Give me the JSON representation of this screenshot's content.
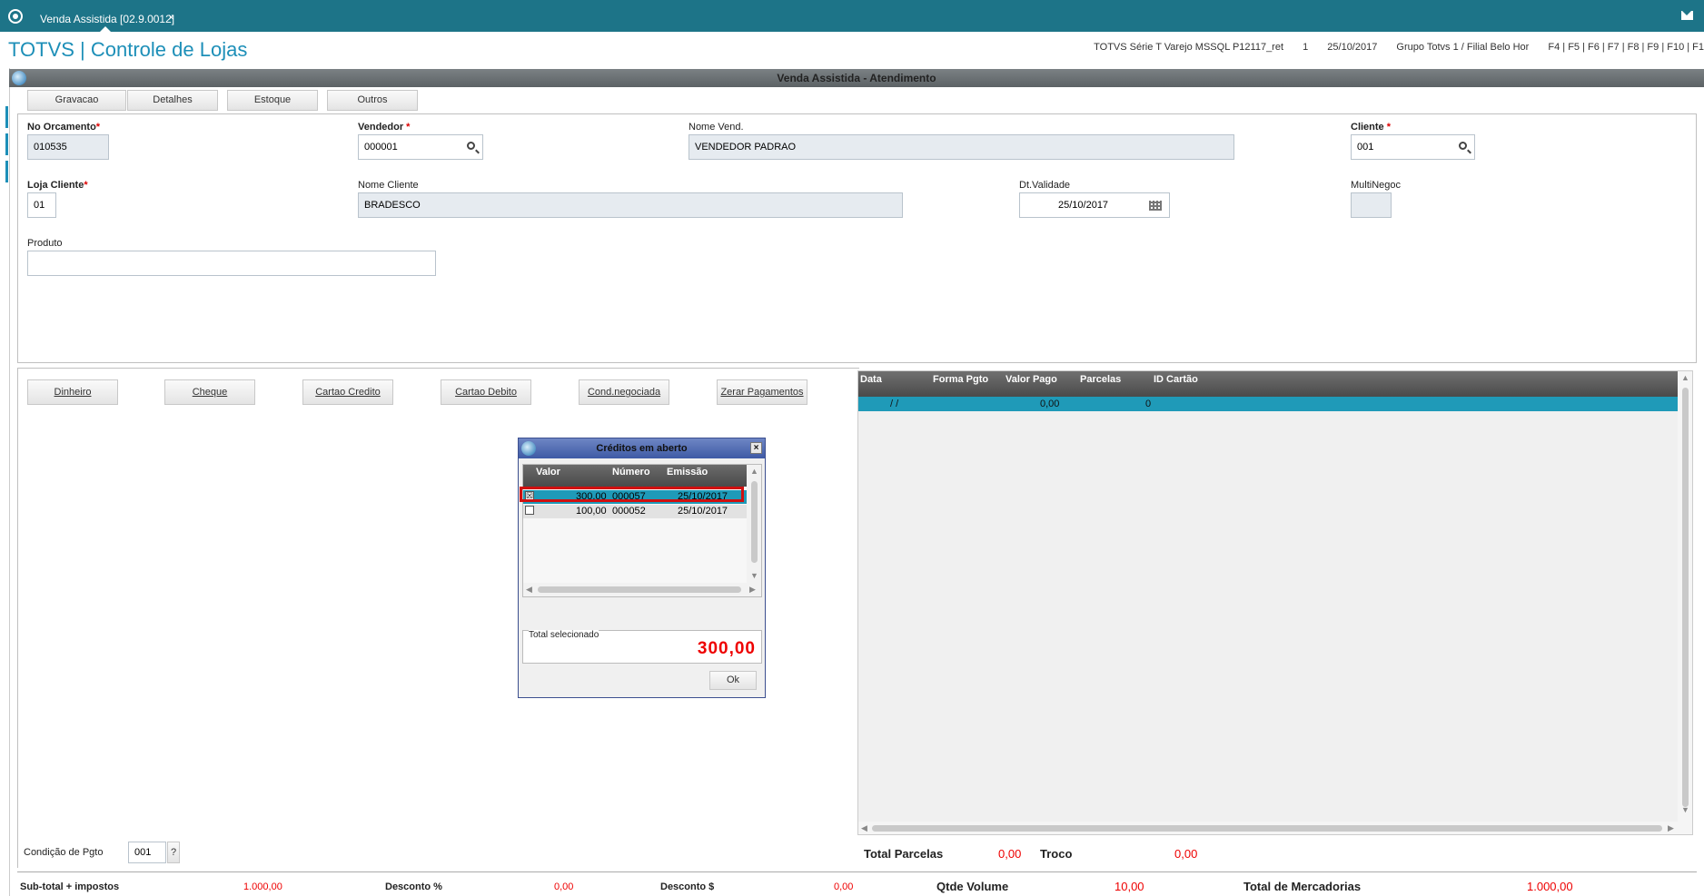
{
  "tab": {
    "label": "Venda Assistida [02.9.0012]",
    "close": "×"
  },
  "header": {
    "title": "TOTVS | Controle de Lojas",
    "info": [
      "TOTVS Série T Varejo MSSQL P12117_ret",
      "1",
      "25/10/2017",
      "Grupo Totvs 1 / Filial Belo Hor",
      "F4 | F5 | F6 | F7 | F8 | F9 | F10 | F1"
    ]
  },
  "window": {
    "title": "Venda Assistida - Atendimento"
  },
  "toolbar": [
    "Gravacao",
    "Detalhes",
    "Estoque",
    "Outros"
  ],
  "form": {
    "orcamento": {
      "label": "No Orcamento",
      "req": "*",
      "value": "010535"
    },
    "vendedor": {
      "label": "Vendedor",
      "req": " *",
      "value": "000001"
    },
    "nome_vend": {
      "label": "Nome Vend.",
      "value": "VENDEDOR PADRAO"
    },
    "cliente": {
      "label": "Cliente",
      "req": " *",
      "value": "001"
    },
    "loja": {
      "label": "Loja Cliente",
      "req": "*",
      "value": "01"
    },
    "nome_cliente": {
      "label": "Nome Cliente",
      "value": "BRADESCO"
    },
    "validade": {
      "label": "Dt.Validade",
      "value": "25/10/2017"
    },
    "multinegoc": {
      "label": "MultiNegoc",
      "value": ""
    },
    "produto": {
      "label": "Produto",
      "value": ""
    }
  },
  "payment_buttons": [
    "Dinheiro",
    "Cheque",
    "Cartao Credito",
    "Cartao Debito",
    "Cond.negociada",
    "Zerar Pagamentos"
  ],
  "grid": {
    "columns": [
      "Data",
      "Forma Pgto",
      "Valor Pago",
      "Parcelas",
      "ID Cartão"
    ],
    "row": {
      "data": "/ /",
      "forma": "",
      "valor": "0,00",
      "parcelas": "0",
      "id": ""
    }
  },
  "dialog": {
    "title": "Créditos em aberto",
    "close": "×",
    "columns": [
      "Valor",
      "Número",
      "Emissão"
    ],
    "rows": [
      {
        "checked": "☒",
        "valor": "300,00",
        "numero": "000057",
        "emissao": "25/10/2017"
      },
      {
        "checked": "",
        "valor": "100,00",
        "numero": "000052",
        "emissao": "25/10/2017"
      }
    ],
    "total_label": "Total selecionado",
    "total_value": "300,00",
    "ok": "Ok"
  },
  "condicao": {
    "label": "Condição de Pgto",
    "value": "001",
    "help": "?"
  },
  "totals": {
    "parcelas_label": "Total Parcelas",
    "parcelas_value": "0,00",
    "troco_label": "Troco",
    "troco_value": "0,00"
  },
  "summary": {
    "subtotal_label": "Sub-total + impostos",
    "subtotal_value": "1.000,00",
    "desc_pct_label": "Desconto %",
    "desc_pct_value": "0,00",
    "desc_val_label": "Desconto $",
    "desc_val_value": "0,00",
    "qtde_label": "Qtde Volume",
    "qtde_value": "10,00",
    "merc_label": "Total de Mercadorias",
    "merc_value": "1.000,00"
  },
  "colors": {
    "topbar": "#1d7488",
    "accent": "#1d8fb8",
    "selected_row": "#1f9ab8",
    "total_red": "#e00000"
  }
}
